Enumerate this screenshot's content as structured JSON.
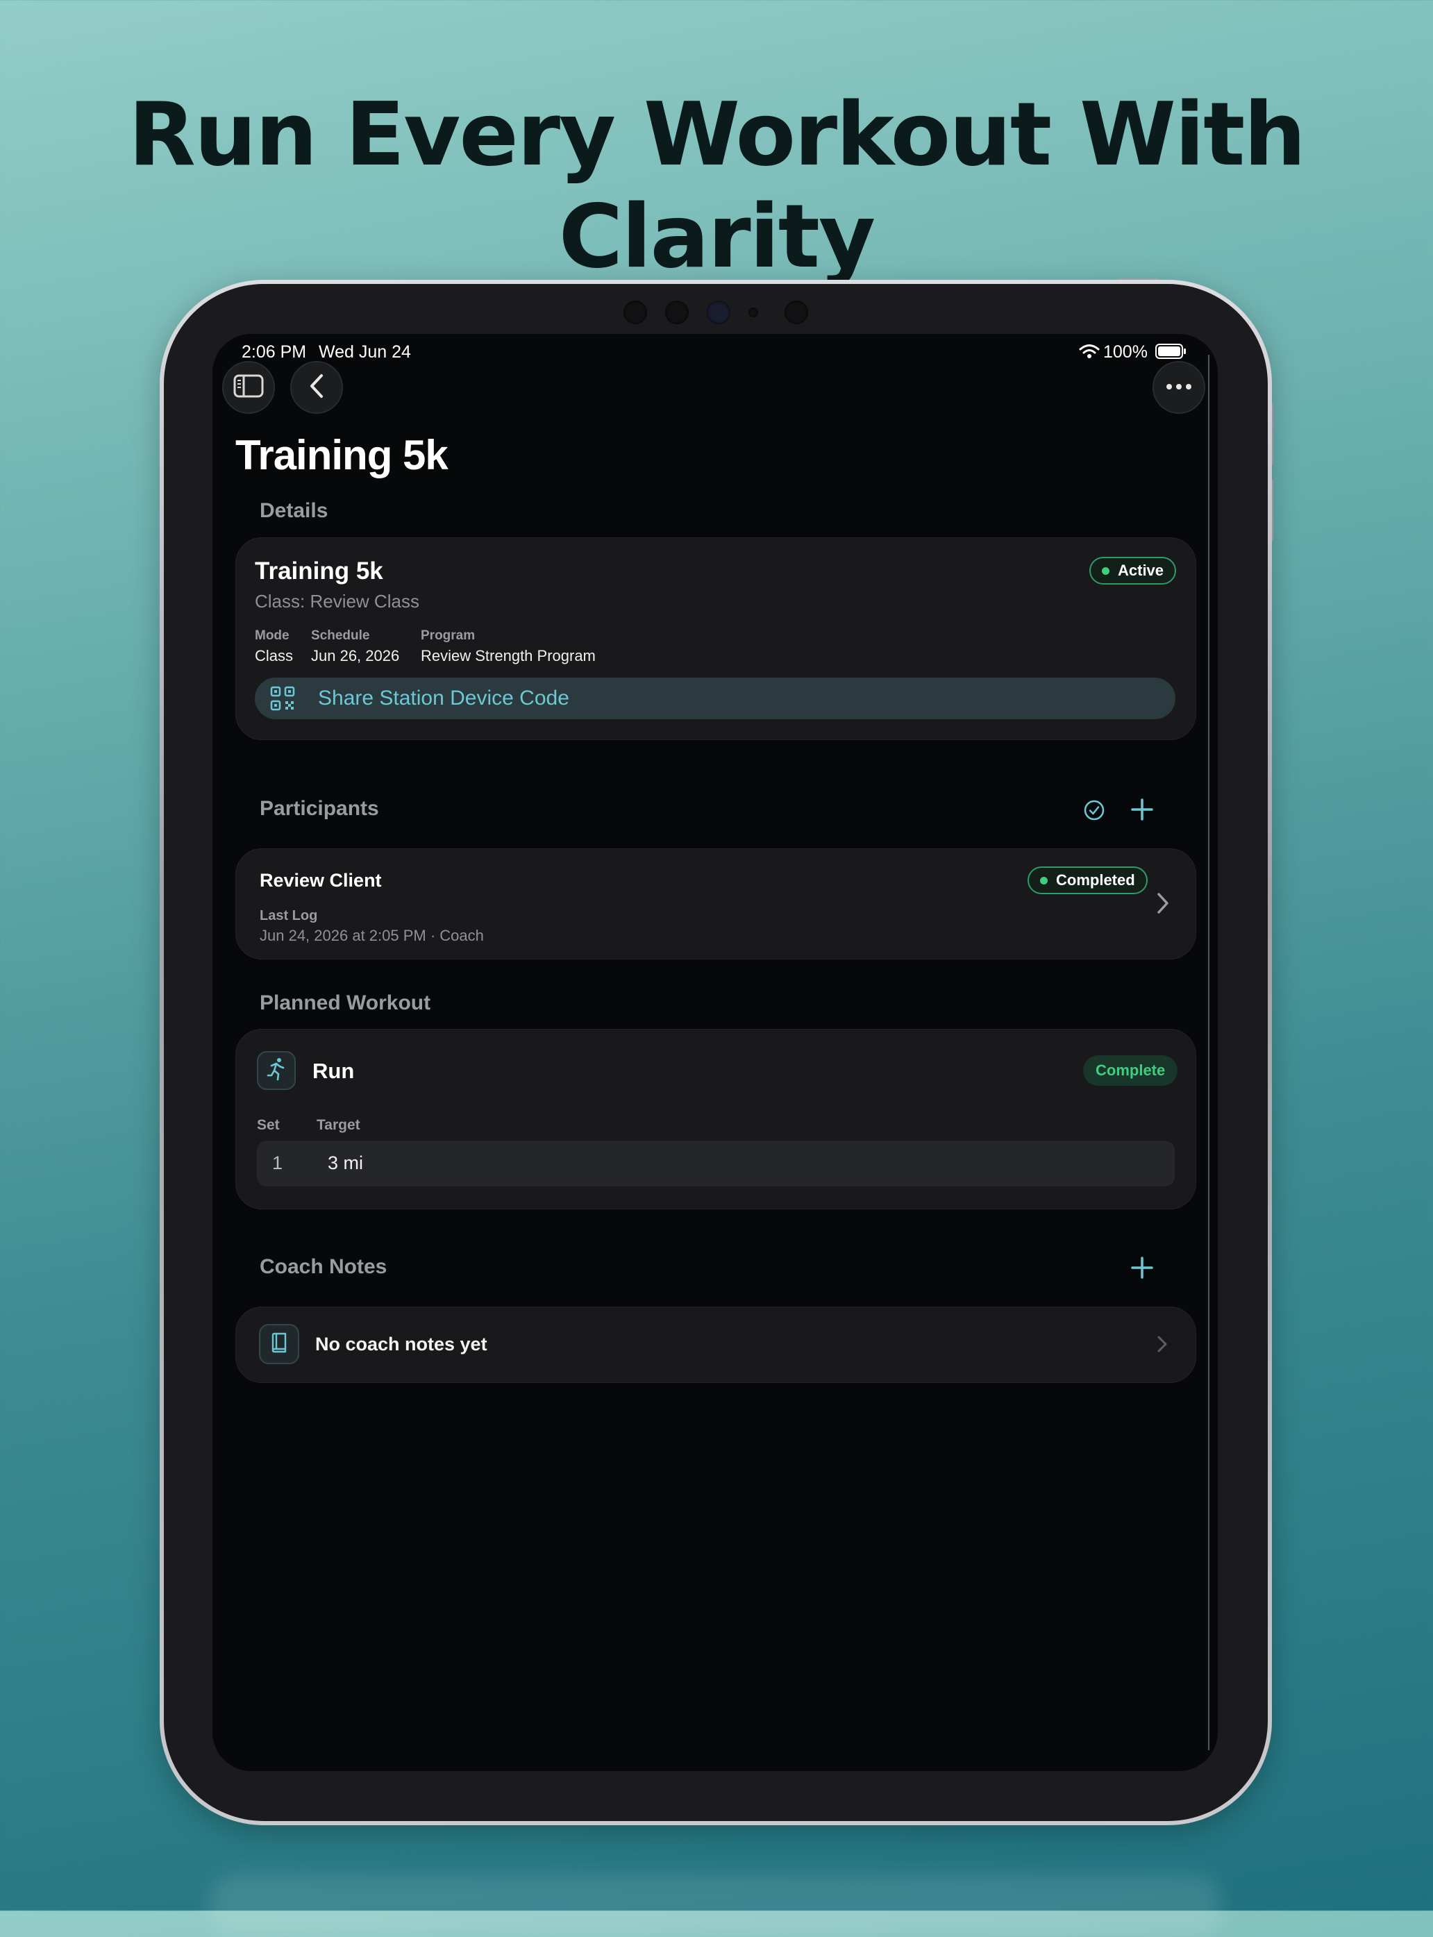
{
  "marketing": {
    "headline": "Run Every Workout With Clarity"
  },
  "status_bar": {
    "time": "2:06 PM",
    "date": "Wed Jun 24",
    "battery": "100%"
  },
  "nav": {
    "sidebar_icon": "sidebar-icon",
    "back_icon": "chevron-left-icon",
    "more_icon": "ellipsis-icon"
  },
  "page": {
    "title": "Training 5k"
  },
  "details": {
    "section_title": "Details",
    "title": "Training 5k",
    "subtitle": "Class: Review Class",
    "status": "Active",
    "fields": [
      {
        "label": "Mode",
        "value": "Class"
      },
      {
        "label": "Schedule",
        "value": "Jun 26, 2026"
      },
      {
        "label": "Program",
        "value": "Review Strength Program"
      }
    ],
    "share_button": "Share Station Device Code"
  },
  "participants": {
    "section_title": "Participants",
    "items": [
      {
        "name": "Review Client",
        "status": "Completed",
        "log_label": "Last Log",
        "log_value": "Jun 24, 2026 at 2:05 PM · Coach"
      }
    ]
  },
  "planned_workout": {
    "section_title": "Planned Workout",
    "exercise": "Run",
    "status": "Complete",
    "columns": [
      "Set",
      "Target"
    ],
    "rows": [
      {
        "set": "1",
        "target": "3 mi"
      }
    ]
  },
  "coach_notes": {
    "section_title": "Coach Notes",
    "empty_text": "No coach notes yet"
  },
  "colors": {
    "accent": "#6cc8d4",
    "status_green": "#3ecf7e",
    "card_bg": "#19191c",
    "screen_bg": "#07080a"
  }
}
